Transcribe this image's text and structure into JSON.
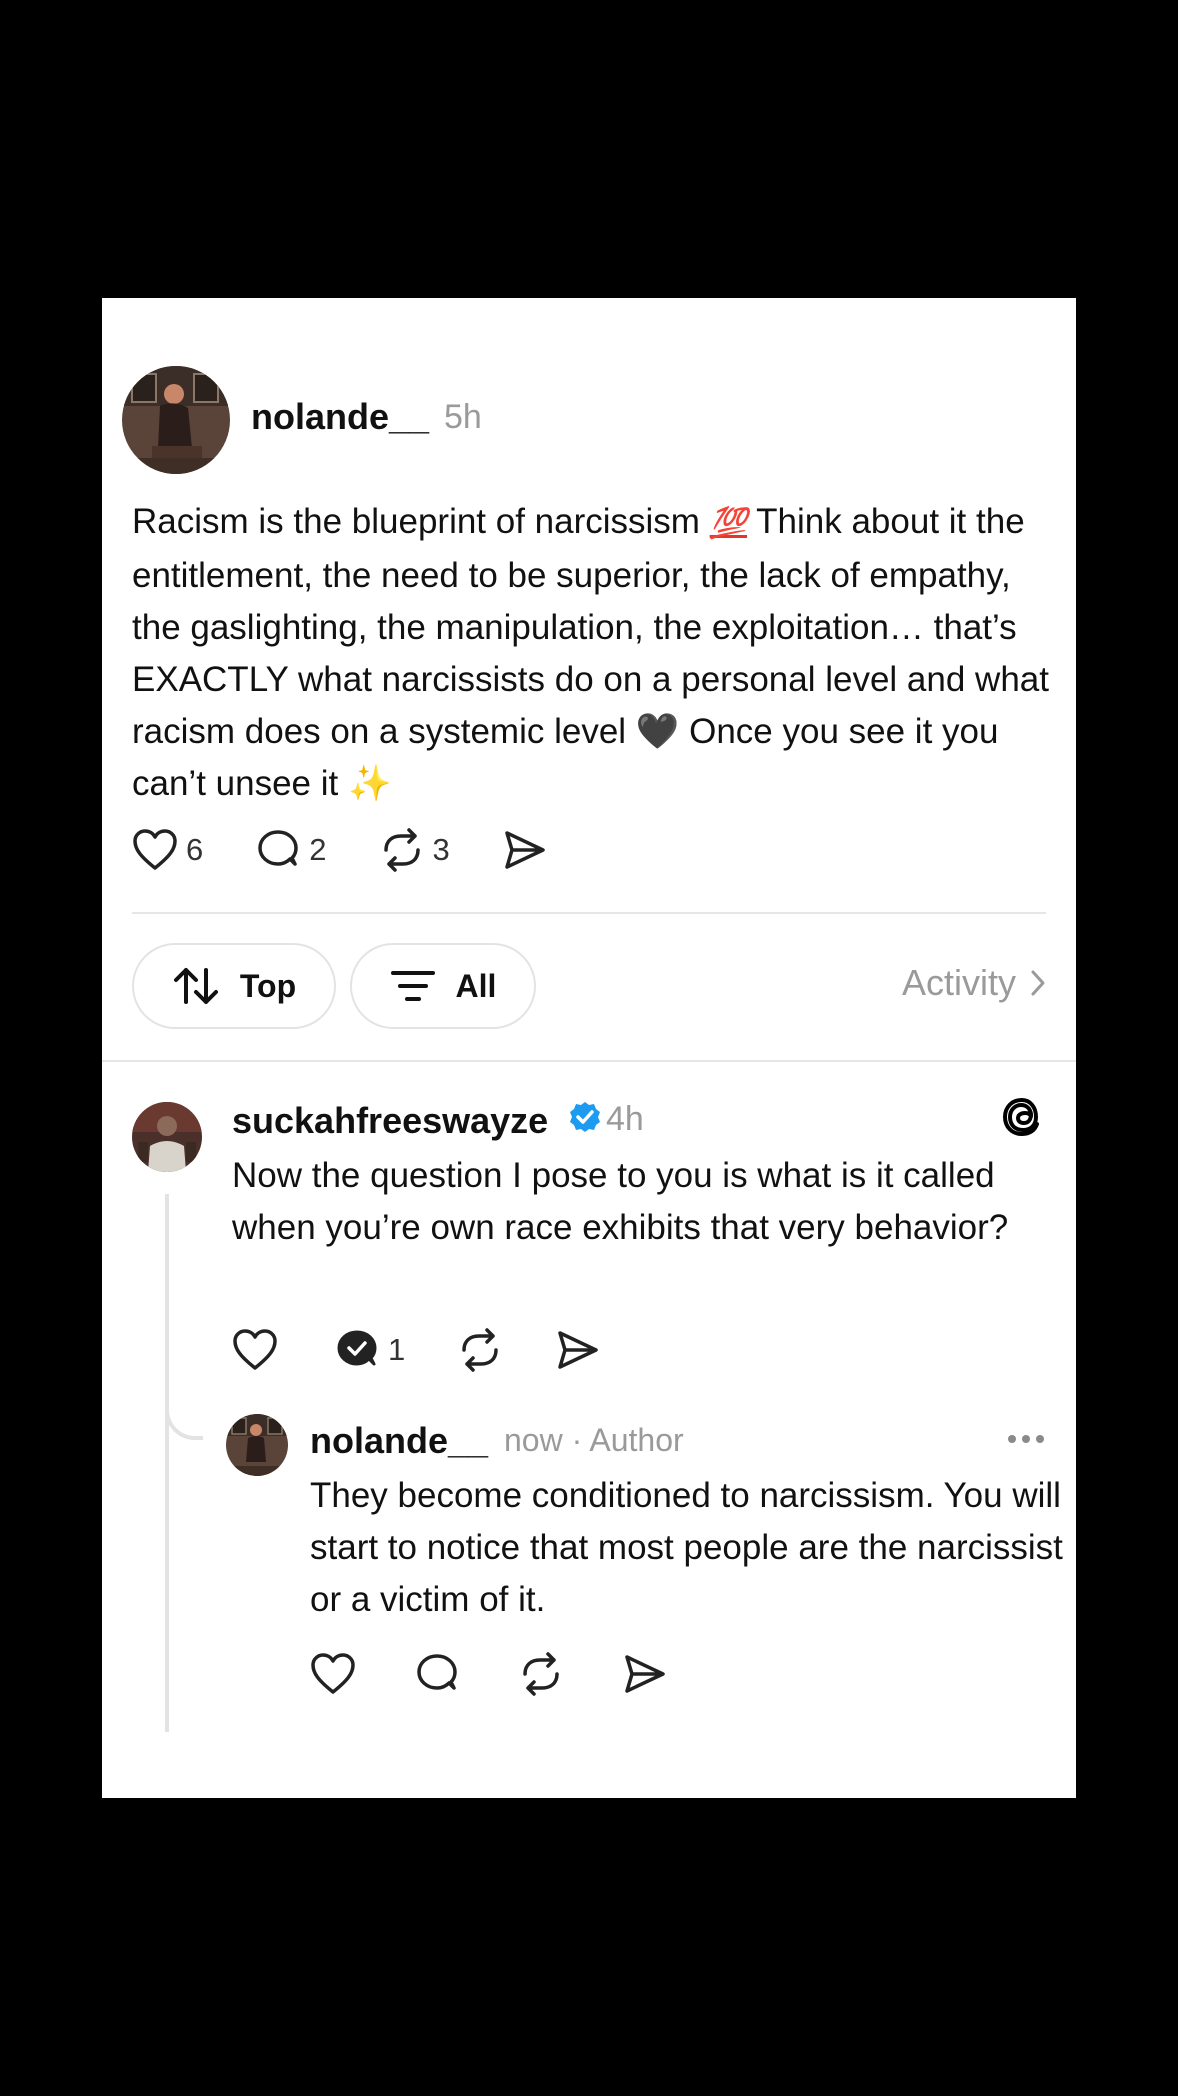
{
  "post": {
    "username": "nolande__",
    "time": "5h",
    "text_before_100": "Racism is the blueprint of narcissism ",
    "emoji_100": "💯",
    "text_middle": " Think about it the entitlement, the need to be superior, the lack of empathy, the gaslighting, the manipulation, the exploitation… that’s EXACTLY what narcissists do on a personal level and what racism does on a systemic level ",
    "emoji_heart": "🖤",
    "text_after_heart": " Once you see it you can’t unsee it ",
    "emoji_sparkles": "✨",
    "likes": "6",
    "comments": "2",
    "reposts": "3"
  },
  "filters": {
    "sort_label": "Top",
    "filter_label": "All",
    "activity_label": "Activity"
  },
  "reply": {
    "username": "suckahfreeswayze",
    "time": "4h",
    "text": "Now the question I pose to you is what is it called when you’re own race exhibits that very behavior?",
    "comments": "1"
  },
  "nested_reply": {
    "username": "nolande__",
    "meta": "now · Author",
    "text": "They become conditioned to narcissism. You will start to notice that most people are the narcissist  or a victim of it."
  },
  "colors": {
    "verified": "#1d9bf0",
    "muted": "#9a9a9a",
    "divider": "#e6e6e6"
  }
}
